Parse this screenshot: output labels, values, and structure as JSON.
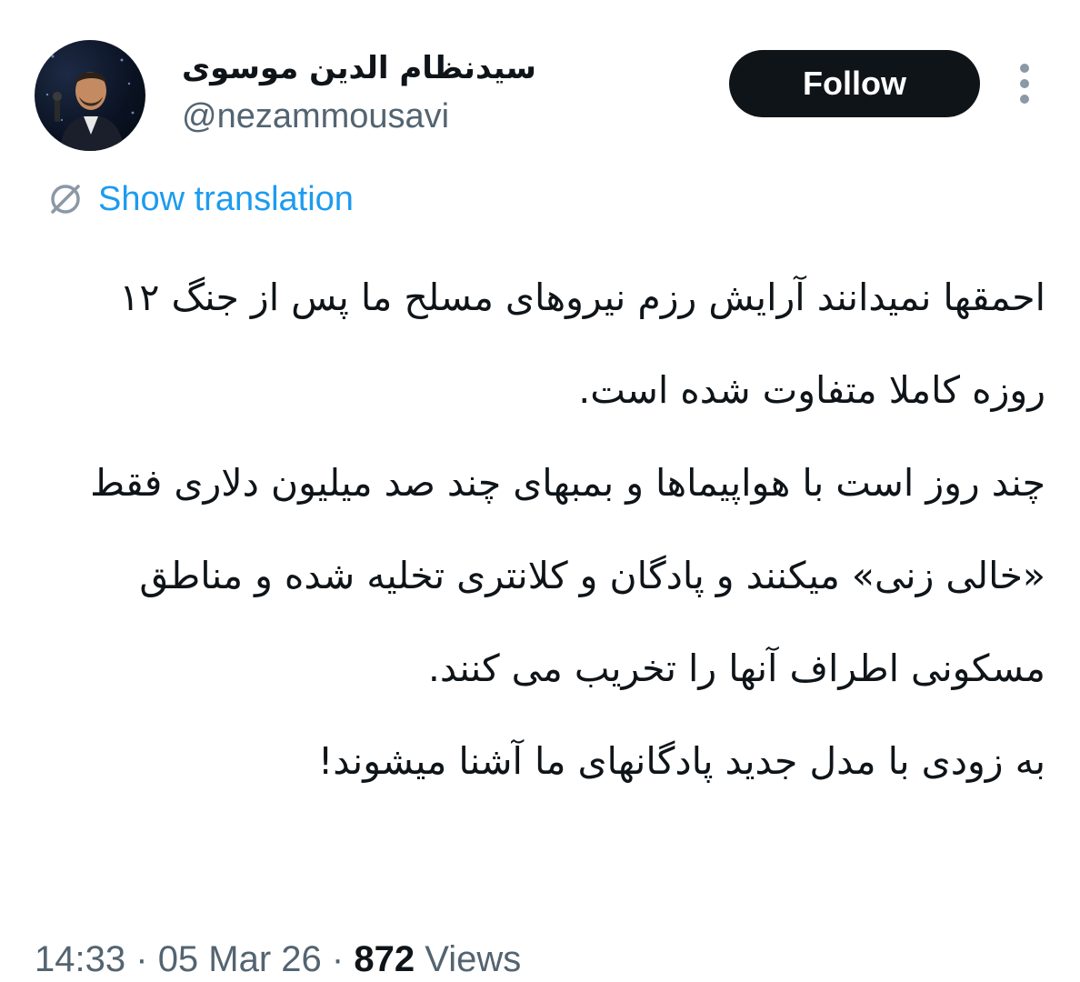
{
  "profile": {
    "display_name": "سیدنظام الدین موسوی",
    "handle": "@nezammousavi",
    "avatar_icon": "profile-photo"
  },
  "actions": {
    "follow_label": "Follow",
    "more_icon": "more-vertical-icon"
  },
  "translation": {
    "label": "Show translation",
    "icon": "translate-icon",
    "color": "#1d9bf0"
  },
  "tweet": {
    "paragraphs": [
      "احمقها نمیدانند آرایش رزم نیروهای مسلح ما پس از جنگ ۱۲ روزه کاملا متفاوت شده است.",
      "چند روز است با هواپیماها و بمبهای چند صد میلیون دلاری فقط «خالی زنی» میکنند و پادگان و کلانتری تخلیه شده و مناطق مسکونی اطراف آنها را تخریب می کنند.",
      "به زودی با مدل جدید پادگانهای ما آشنا میشوند!"
    ]
  },
  "meta": {
    "time": "14:33",
    "separator": "·",
    "date": "05 Mar 26",
    "views_count": "872",
    "views_label": "Views"
  }
}
